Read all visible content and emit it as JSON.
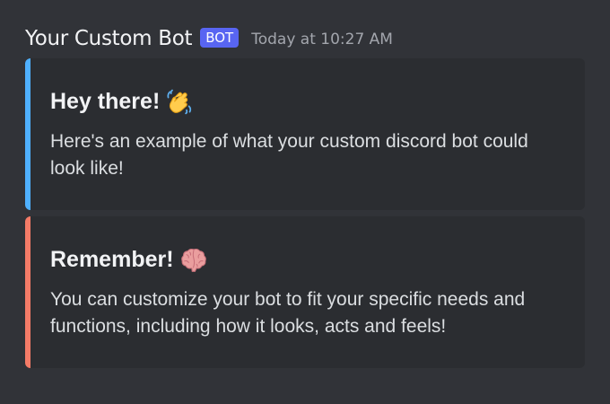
{
  "message": {
    "author": "Your Custom Bot",
    "badge": "BOT",
    "timestamp": "Today at 10:27 AM"
  },
  "embeds": [
    {
      "title": "Hey there!",
      "emoji": "waving-hand-icon",
      "description": "Here's an example of what your custom discord bot could look like!",
      "color": "#4fb0ff"
    },
    {
      "title": "Remember!",
      "emoji": "brain-icon",
      "description": "You can customize your bot to fit your specific needs and functions, including how it looks, acts and feels!",
      "color": "#f47b67"
    }
  ],
  "colors": {
    "background": "#313338",
    "embed_background": "#2b2d31",
    "badge": "#5865f2"
  }
}
